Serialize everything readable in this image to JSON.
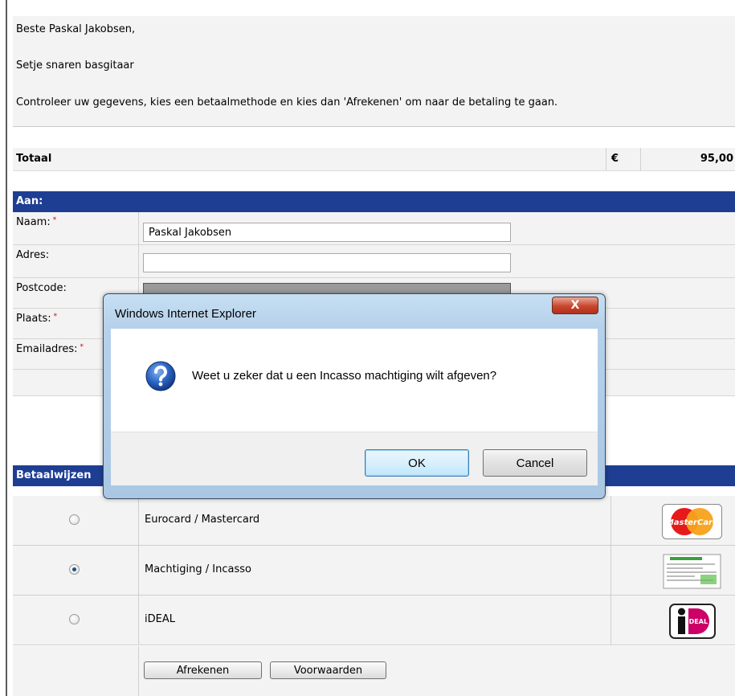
{
  "intro": {
    "greeting": "Beste Paskal Jakobsen,",
    "product": "Setje snaren basgitaar",
    "instruction": "Controleer uw gegevens, kies een betaalmethode en kies dan 'Afrekenen' om naar de betaling te gaan."
  },
  "total": {
    "label": "Totaal",
    "currency": "€",
    "amount": "95,00"
  },
  "to_section": {
    "title": "Aan:",
    "fields": [
      {
        "label": "Naam:",
        "required": true,
        "value": "Paskal Jakobsen"
      },
      {
        "label": "Adres:",
        "required": false,
        "value": ""
      },
      {
        "label": "Postcode:",
        "required": false,
        "value": ""
      },
      {
        "label": "Plaats:",
        "required": true,
        "value": ""
      },
      {
        "label": "Emailadres:",
        "required": true,
        "value": ""
      }
    ],
    "required_marker": "*"
  },
  "payment": {
    "title": "Betaalwijzen",
    "methods": [
      {
        "label": "Eurocard / Mastercard",
        "selected": false,
        "logo": "mastercard-logo",
        "logo_text": "MasterCard"
      },
      {
        "label": "Machtiging / Incasso",
        "selected": true,
        "logo": "incasso-form-logo"
      },
      {
        "label": "iDEAL",
        "selected": false,
        "logo": "ideal-logo",
        "logo_text": "iDEAL"
      }
    ],
    "buttons": {
      "checkout": "Afrekenen",
      "terms": "Voorwaarden"
    }
  },
  "dialog": {
    "title": "Windows Internet Explorer",
    "close_label": "X",
    "icon": "question-icon",
    "message": "Weet u zeker dat u een Incasso machtiging wilt afgeven?",
    "ok": "OK",
    "cancel": "Cancel"
  },
  "colors": {
    "section_header": "#1e3e93",
    "required": "#cc0000",
    "row_background": "#f3f3f3"
  }
}
